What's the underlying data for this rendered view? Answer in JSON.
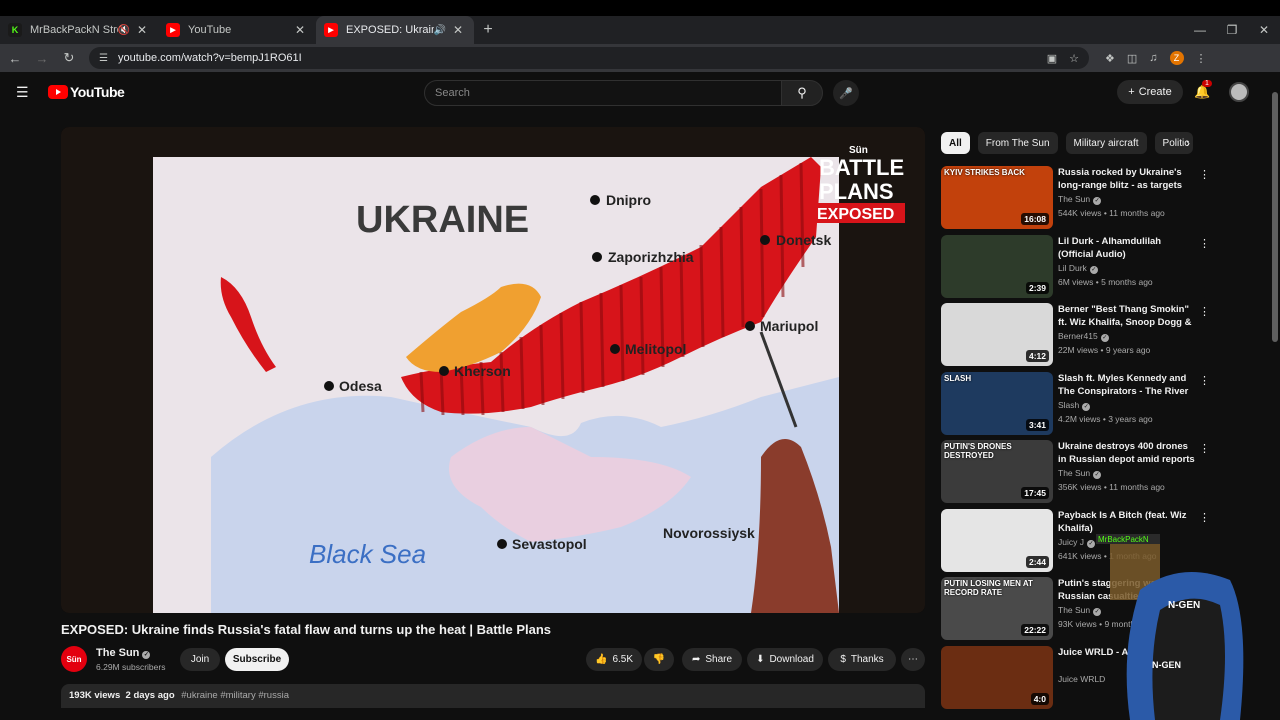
{
  "browser": {
    "tabs": [
      {
        "title": "MrBackPackN Stream - Wa",
        "favicon": "kick-icon",
        "muted": true
      },
      {
        "title": "YouTube",
        "favicon": "youtube-icon"
      },
      {
        "title": "EXPOSED: Ukraine finds Ru",
        "favicon": "youtube-icon",
        "active": true,
        "audio": true
      }
    ],
    "url": "youtube.com/watch?v=bempJ1RO61I",
    "profile_initial": "Z"
  },
  "header": {
    "logo_text": "YouTube",
    "search_placeholder": "Search",
    "create_label": "Create",
    "notification_count": "1"
  },
  "video": {
    "title": "EXPOSED: Ukraine finds Russia's fatal flaw and turns up the heat | Battle Plans",
    "map": {
      "country": "UKRAINE",
      "sea": "Black Sea",
      "cities": [
        "Dnipro",
        "Zaporizhzhia",
        "Donetsk",
        "Mariupol",
        "Melitopol",
        "Kherson",
        "Odesa",
        "Sevastopol",
        "Novorossiysk"
      ],
      "overlay_brand": "Sün",
      "overlay_title_1": "BATTLE",
      "overlay_title_2": "PLANS",
      "overlay_title_3": "EXPOSED"
    },
    "channel": {
      "name": "The Sun",
      "avatar_text": "Sün",
      "subscribers": "6.29M subscribers"
    },
    "join_label": "Join",
    "subscribe_label": "Subscribe",
    "likes": "6.5K",
    "share_label": "Share",
    "download_label": "Download",
    "thanks_label": "Thanks",
    "views": "193K views",
    "age": "2 days ago",
    "tags": "#ukraine #military #russia"
  },
  "chips": [
    "All",
    "From The Sun",
    "Military aircraft",
    "Politic"
  ],
  "recommendations": [
    {
      "title": "Russia rocked by Ukraine's long-range blitz - as targets revealed...",
      "channel": "The Sun",
      "verified": true,
      "views": "544K views",
      "age": "11 months ago",
      "duration": "16:08",
      "thumb_label": "KYIV STRIKES BACK",
      "thumb_color": "#c2410c"
    },
    {
      "title": "Lil Durk - Alhamdulilah (Official Audio)",
      "channel": "Lil Durk",
      "verified": true,
      "views": "6M views",
      "age": "5 months ago",
      "duration": "2:39",
      "thumb_label": "",
      "thumb_color": "#2d3b2a"
    },
    {
      "title": "Berner \"Best Thang Smokin\" ft. Wiz Khalifa, Snoop Dogg & B-...",
      "channel": "Berner415",
      "verified": true,
      "views": "22M views",
      "age": "9 years ago",
      "duration": "4:12",
      "thumb_label": "",
      "thumb_color": "#d9d9d9"
    },
    {
      "title": "Slash ft. Myles Kennedy and The Conspirators - The River I...",
      "channel": "Slash",
      "verified": true,
      "views": "4.2M views",
      "age": "3 years ago",
      "duration": "3:41",
      "thumb_label": "SLASH",
      "thumb_color": "#1e3a5f"
    },
    {
      "title": "Ukraine destroys 400 drones in Russian depot amid reports ...",
      "channel": "The Sun",
      "verified": true,
      "views": "356K views",
      "age": "11 months ago",
      "duration": "17:45",
      "thumb_label": "PUTIN'S DRONES DESTROYED",
      "thumb_color": "#3b3b3b"
    },
    {
      "title": "Payback Is A Bitch (feat. Wiz Khalifa)",
      "channel": "Juicy J",
      "verified": true,
      "views": "641K views",
      "age": "1 month ago",
      "duration": "2:44",
      "thumb_label": "",
      "thumb_color": "#e5e5e5"
    },
    {
      "title": "Putin's staggering war: Russian casualties hit new...",
      "channel": "The Sun",
      "verified": true,
      "views": "93K views",
      "age": "9 months ago",
      "duration": "22:22",
      "thumb_label": "PUTIN LOSING MEN AT RECORD RATE",
      "thumb_color": "#4a4a4a"
    },
    {
      "title": "Juice WRLD - Audio)",
      "channel": "Juice WRLD",
      "verified": false,
      "views": "",
      "age": "",
      "duration": "4:0",
      "thumb_label": "",
      "thumb_color": "#6b2d12"
    }
  ],
  "overlay": {
    "chair_text": "N-GEN",
    "username": "MrBackPackN"
  },
  "colors": {
    "youtube_red": "#ff0000",
    "occupied_red": "#d7141a",
    "kherson_orange": "#f0a030",
    "sea": "#c8d6ee"
  }
}
